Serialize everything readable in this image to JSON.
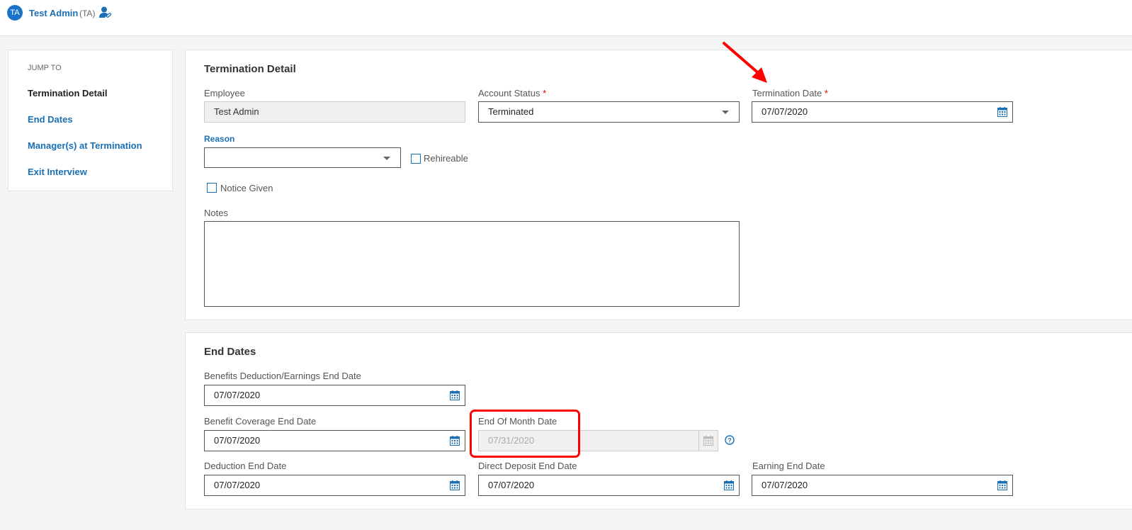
{
  "header": {
    "avatar_initials": "TA",
    "user_name": "Test Admin",
    "user_abbr": "(TA)",
    "icon": "user-link-icon"
  },
  "sidebar": {
    "title": "JUMP TO",
    "items": [
      {
        "label": "Termination Detail",
        "active": true
      },
      {
        "label": "End Dates"
      },
      {
        "label": "Manager(s) at Termination"
      },
      {
        "label": "Exit Interview"
      }
    ]
  },
  "termination": {
    "title": "Termination Detail",
    "employee": {
      "label": "Employee",
      "value": "Test Admin"
    },
    "account_status": {
      "label": "Account Status",
      "required": "*",
      "value": "Terminated"
    },
    "termination_date": {
      "label": "Termination Date",
      "required": "*",
      "value": "07/07/2020"
    },
    "reason": {
      "label": "Reason",
      "value": ""
    },
    "rehireable": {
      "label": "Rehireable",
      "checked": false
    },
    "notice_given": {
      "label": "Notice Given",
      "checked": false
    },
    "notes": {
      "label": "Notes",
      "value": ""
    }
  },
  "end_dates": {
    "title": "End Dates",
    "benefits_deduction": {
      "label": "Benefits Deduction/Earnings End Date",
      "value": "07/07/2020"
    },
    "benefit_coverage": {
      "label": "Benefit Coverage End Date",
      "value": "07/07/2020"
    },
    "end_of_month": {
      "label": "End Of Month Date",
      "value": "07/31/2020",
      "disabled": true
    },
    "deduction": {
      "label": "Deduction End Date",
      "value": "07/07/2020"
    },
    "direct_deposit": {
      "label": "Direct Deposit End Date",
      "value": "07/07/2020"
    },
    "earning": {
      "label": "Earning End Date",
      "value": "07/07/2020"
    }
  },
  "colors": {
    "accent": "#1a6fb5",
    "annotation": "#ff0000"
  }
}
